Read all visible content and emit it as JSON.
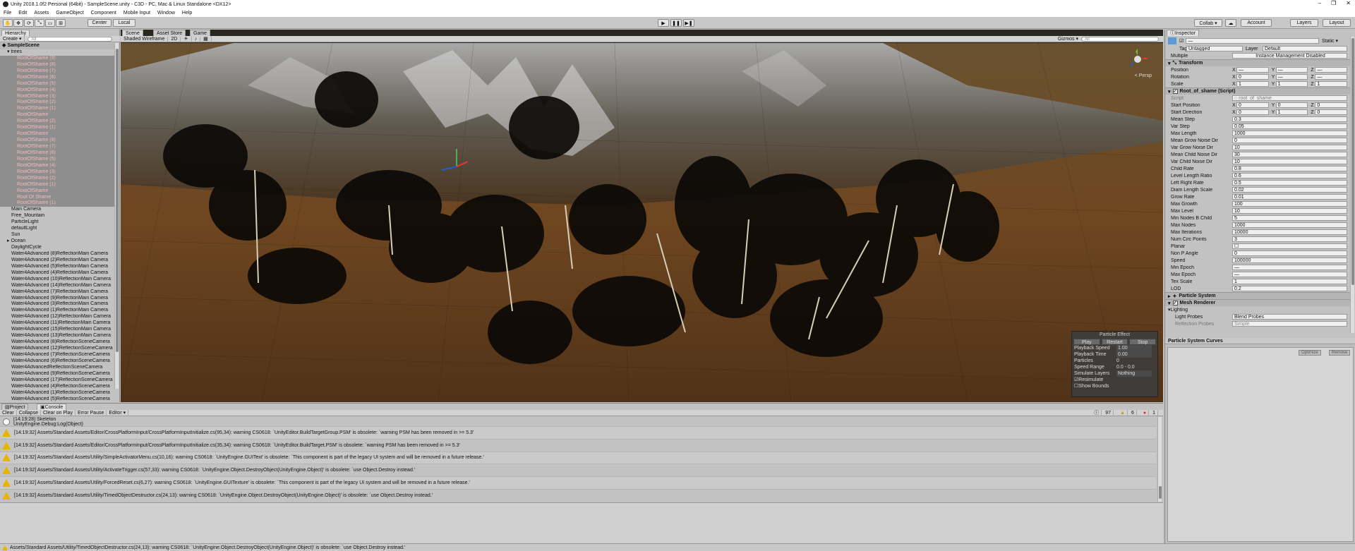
{
  "window": {
    "title": "Unity 2018.1.0f2 Personal (64bit) - SampleScene.unity - C3D - PC, Mac & Linux Standalone <DX12>",
    "minimize": "–",
    "maximize": "❐",
    "close": "✕"
  },
  "menu": [
    "File",
    "Edit",
    "Assets",
    "GameObject",
    "Component",
    "Mobile Input",
    "Window",
    "Help"
  ],
  "toolbar": {
    "center": "Center",
    "local": "Local",
    "collab": "Collab ▾",
    "account": "Account",
    "layers": "Layers",
    "layout": "Layout"
  },
  "hierarchy": {
    "tab": "Hierarchy",
    "create": "Create ▾",
    "search_placeholder": "All",
    "scene_name": "SampleScene",
    "group": "trees",
    "selected_items": [
      "RootOfShame (9)",
      "RootOfShame (8)",
      "RootOfShame (7)",
      "RootOfShame (6)",
      "RootOfShame (5)",
      "RootOfShame (4)",
      "RootOfShame (3)",
      "RootOfShame (2)",
      "RootOfShame (1)",
      "RootOfShame",
      "RootOfShame (2)",
      "RootOfShame (1)",
      "RootOfShame",
      "RootOfShame (8)",
      "RootOfShame (7)",
      "RootOfShame (6)",
      "RootOfShame (5)",
      "RootOfShame (4)",
      "RootOfShame (3)",
      "RootOfShame (2)",
      "RootOfShame (1)",
      "RootOfShame",
      "Root Of Shame",
      "RootOfShame (1)"
    ],
    "items": [
      "Main Camera",
      "Free_Mountain",
      "ParticleLight",
      "defaultLight",
      "Sun",
      "Ocean",
      "DaylightCycle",
      "Water4Advanced (8)ReflectionMain Camera",
      "Water4Advanced (2)ReflectionMain Camera",
      "Water4Advanced (5)ReflectionMain Camera",
      "Water4Advanced (4)ReflectionMain Camera",
      "Water4Advanced (10)ReflectionMain Camera",
      "Water4Advanced (14)ReflectionMain Camera",
      "Water4Advanced (7)ReflectionMain Camera",
      "Water4Advanced (9)ReflectionMain Camera",
      "Water4Advanced (3)ReflectionMain Camera",
      "Water4Advanced (1)ReflectionMain Camera",
      "Water4Advanced (12)ReflectionMain Camera",
      "Water4Advanced (11)ReflectionMain Camera",
      "Water4Advanced (15)ReflectionMain Camera",
      "Water4Advanced (13)ReflectionMain Camera",
      "Water4Advanced (8)ReflectionSceneCamera",
      "Water4Advanced (12)ReflectionSceneCamera",
      "Water4Advanced (7)ReflectionSceneCamera",
      "Water4Advanced (6)ReflectionSceneCamera",
      "Water4AdvancedReflectionSceneCamera",
      "Water4Advanced (9)ReflectionSceneCamera",
      "Water4Advanced (17)ReflectionSceneCamera",
      "Water4Advanced (4)ReflectionSceneCamera",
      "Water4Advanced (1)ReflectionSceneCamera",
      "Water4Advanced (5)ReflectionSceneCamera"
    ]
  },
  "scene": {
    "tabs": [
      "Scene",
      "Asset Store",
      "Game"
    ],
    "shading": "Shaded Wireframe",
    "mode_2d": "2D",
    "gizmos": "Gizmos ▾",
    "search_placeholder": "All",
    "persp": "< Persp",
    "particle_effect": {
      "title": "Particle Effect",
      "play": "Play",
      "restart": "Restart",
      "stop": "Stop",
      "rows": [
        {
          "k": "Playback Speed",
          "v": "1.00"
        },
        {
          "k": "Playback Time",
          "v": "0.00"
        },
        {
          "k": "Particles",
          "v": "0"
        },
        {
          "k": "Speed Range",
          "v": "0.0 - 0.0"
        },
        {
          "k": "Simulate Layers",
          "v": "Nothing"
        }
      ],
      "resimulate": "Resimulate",
      "show_bounds": "Show Bounds"
    }
  },
  "inspector": {
    "tab": "Inspector",
    "name_value": "—",
    "static": "Static ▾",
    "tag_label": "Tag",
    "tag_value": "Untagged",
    "layer_label": "Layer",
    "layer_value": "Default",
    "multiple_label": "Multiple",
    "multiple_value": "Instance Management Disabled",
    "transform": "Transform",
    "position": "Position",
    "rotation": "Rotation",
    "scale": "Scale",
    "pos": [
      "—",
      "—",
      "—"
    ],
    "rot": [
      "0",
      "—",
      "—"
    ],
    "scl": [
      "1",
      "1",
      "1"
    ],
    "script_comp": "Root_of_shame (Script)",
    "script_label": "Script",
    "script_value": "○ root_of_shame",
    "start_position": "Start Position",
    "sp": [
      "0",
      "0",
      "0"
    ],
    "start_direction": "Start Direction",
    "sd": [
      "0",
      "1",
      "0"
    ],
    "fields": [
      {
        "k": "Mean Step",
        "v": "0.3"
      },
      {
        "k": "Var Step",
        "v": "0.05"
      },
      {
        "k": "Max Length",
        "v": "1000"
      },
      {
        "k": "Mean Grow Noise Dir",
        "v": "0"
      },
      {
        "k": "Var Grow Noise Dir",
        "v": "10"
      },
      {
        "k": "Mean Child Noise Dir",
        "v": "30"
      },
      {
        "k": "Var Child Noise Dir",
        "v": "10"
      },
      {
        "k": "Child Rate",
        "v": "0.8"
      },
      {
        "k": "Level Length Ratio",
        "v": "0.6"
      },
      {
        "k": "Left Right Rate",
        "v": "0.5"
      },
      {
        "k": "Diam Length Scale",
        "v": "0.02"
      },
      {
        "k": "Grow Rate",
        "v": "0.01"
      },
      {
        "k": "Max Growth",
        "v": "100"
      },
      {
        "k": "Max Level",
        "v": "10"
      },
      {
        "k": "Min Nodes B Child",
        "v": "5"
      },
      {
        "k": "Max Nodes",
        "v": "1000"
      },
      {
        "k": "Max Iterations",
        "v": "10000"
      },
      {
        "k": "Num Circ Points",
        "v": "3"
      },
      {
        "k": "Planar",
        "v": "☐"
      },
      {
        "k": "Non P Angle",
        "v": "0"
      },
      {
        "k": "Speed",
        "v": "100000"
      },
      {
        "k": "Min Epoch",
        "v": "—"
      },
      {
        "k": "Max Epoch",
        "v": "—"
      },
      {
        "k": "Tex Scale",
        "v": "1"
      },
      {
        "k": "LOD",
        "v": "0.2"
      }
    ],
    "particle_system": "Particle System",
    "mesh_renderer": "Mesh Renderer",
    "lighting": "Lighting",
    "light_probes": "Light Probes",
    "light_probes_value": "Blend Probes",
    "reflection_probes": "Reflection Probes",
    "reflection_probes_value": "Simple"
  },
  "curves": {
    "title": "Particle System Curves",
    "optimize": "Optimize",
    "remove": "Remove"
  },
  "console": {
    "tabs": [
      "Project",
      "Console"
    ],
    "buttons": [
      "Clear",
      "Collapse",
      "Clear on Play",
      "Error Pause",
      "Editor ▾"
    ],
    "count_info": "97",
    "count_warn": "6",
    "count_err": "1",
    "rows": [
      {
        "type": "info",
        "text": "[14:19:28] Skeleton\nUnityEngine.Debug:Log(Object)"
      },
      {
        "type": "warn",
        "text": "[14:19:32] Assets/Standard Assets/Editor/CrossPlatformInput/CrossPlatformInputInitialize.cs(95,34): warning CS0618: `UnityEditor.BuildTargetGroup.PSM' is obsolete: `warning PSM has been removed in >= 5.3'"
      },
      {
        "type": "warn",
        "text": "[14:19:32] Assets/Standard Assets/Editor/CrossPlatformInput/CrossPlatformInputInitialize.cs(35,34): warning CS0618: `UnityEditor.BuildTarget.PSM' is obsolete: `warning PSM has been removed in >= 5.3'"
      },
      {
        "type": "warn",
        "text": "[14:19:32] Assets/Standard Assets/Utility/SimpleActivatorMenu.cs(10,16): warning CS0618: `UnityEngine.GUIText' is obsolete: `This component is part of the legacy UI system and will be removed in a future release.'"
      },
      {
        "type": "warn",
        "text": "[14:19:32] Assets/Standard Assets/Utility/ActivateTrigger.cs(57,33): warning CS0618: `UnityEngine.Object.DestroyObject(UnityEngine.Object)' is obsolete: `use Object.Destroy instead.'"
      },
      {
        "type": "warn",
        "text": "[14:19:32] Assets/Standard Assets/Utility/ForcedReset.cs(6,27): warning CS0618: `UnityEngine.GUITexture' is obsolete: `This component is part of the legacy UI system and will be removed in a future release.'"
      },
      {
        "type": "warn",
        "text": "[14:19:32] Assets/Standard Assets/Utility/TimedObjectDestructor.cs(24,13): warning CS0618: `UnityEngine.Object.DestroyObject(UnityEngine.Object)' is obsolete: `use Object.Destroy instead.'"
      }
    ]
  },
  "status": "Assets/Standard Assets/Utility/TimedObjectDestructor.cs(24,13): warning CS0618: `UnityEngine.Object.DestroyObject(UnityEngine.Object)' is obsolete: `use Object.Destroy instead.'"
}
